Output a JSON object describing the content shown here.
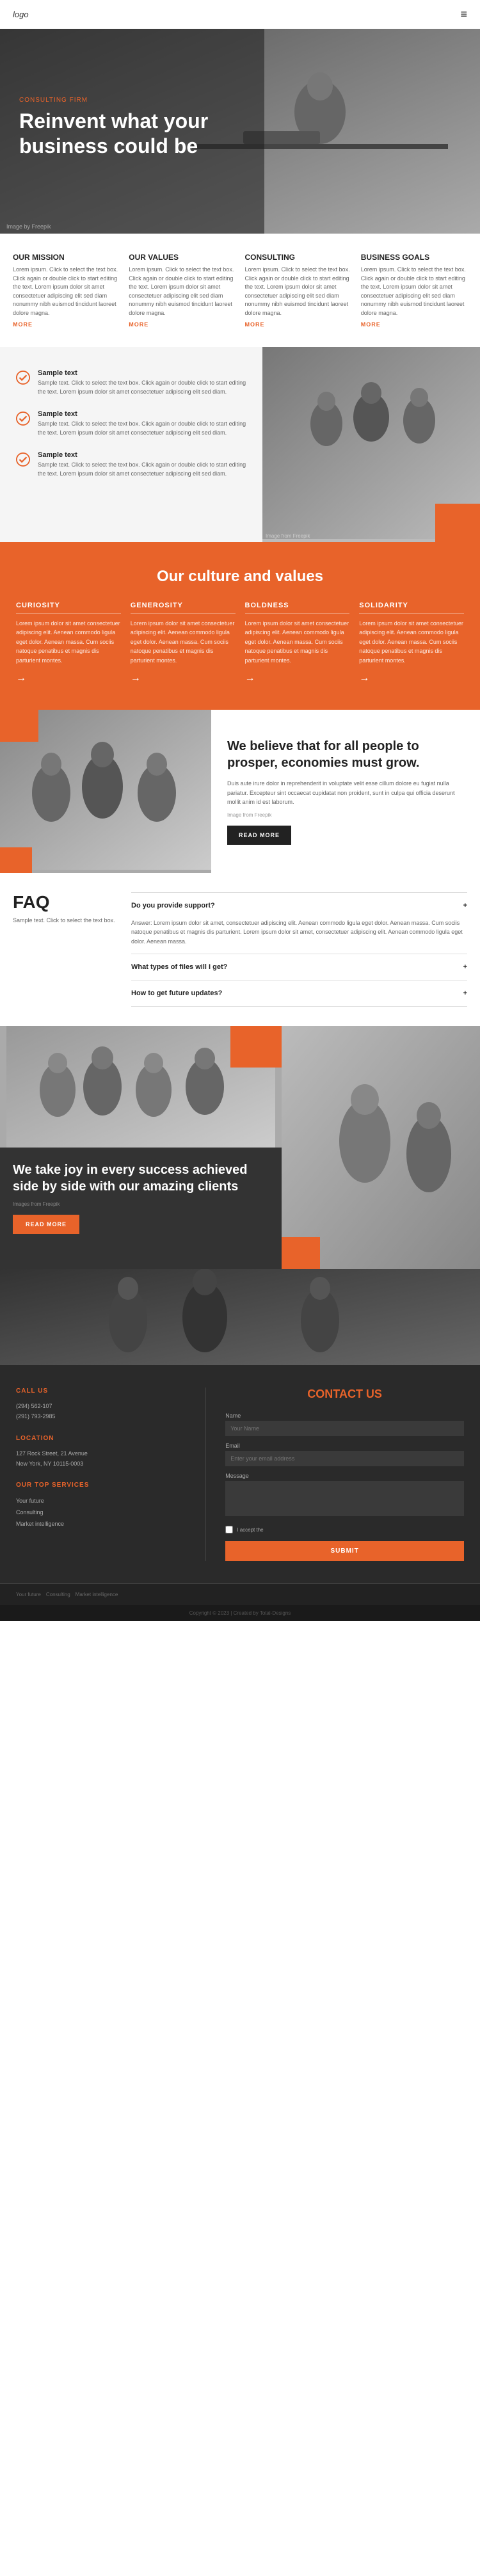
{
  "nav": {
    "logo": "logo",
    "menu_icon": "≡"
  },
  "hero": {
    "tag": "CONSULTING FIRM",
    "title": "Reinvent what your business could be",
    "img_credit": "Image by Freepik"
  },
  "four_cols": [
    {
      "heading": "Our Mission",
      "text": "Lorem ipsum. Click to select the text box. Click again or double click to start editing the text. Lorem ipsum dolor sit amet consectetuer adipiscing elit sed diam nonummy nibh euismod tincidunt laoreet dolore magna.",
      "more": "MORE"
    },
    {
      "heading": "Our Values",
      "text": "Lorem ipsum. Click to select the text box. Click again or double click to start editing the text. Lorem ipsum dolor sit amet consectetuer adipiscing elit sed diam nonummy nibh euismod tincidunt laoreet dolore magna.",
      "more": "MORE"
    },
    {
      "heading": "Consulting",
      "text": "Lorem ipsum. Click to select the text box. Click again or double click to start editing the text. Lorem ipsum dolor sit amet consectetuer adipiscing elit sed diam nonummy nibh euismod tincidunt laoreet dolore magna.",
      "more": "MORE"
    },
    {
      "heading": "Business Goals",
      "text": "Lorem ipsum. Click to select the text box. Click again or double click to start editing the text. Lorem ipsum dolor sit amet consectetuer adipiscing elit sed diam nonummy nibh euismod tincidunt laoreet dolore magna.",
      "more": "MORE"
    }
  ],
  "checklist": {
    "items": [
      {
        "title": "Sample text",
        "text": "Sample text. Click to select the text box. Click again or double click to start editing the text. Lorem ipsum dolor sit amet consectetuer adipiscing elit sed diam."
      },
      {
        "title": "Sample text",
        "text": "Sample text. Click to select the text box. Click again or double click to start editing the text. Lorem ipsum dolor sit amet consectetuer adipiscing elit sed diam."
      },
      {
        "title": "Sample text",
        "text": "Sample text. Click to select the text box. Click again or double click to start editing the text. Lorem ipsum dolor sit amet consectetuer adipiscing elit sed diam."
      }
    ],
    "img_credit": "Image from Freepik"
  },
  "culture": {
    "title": "Our culture and values",
    "cols": [
      {
        "heading": "CURIOSITY",
        "text": "Lorem ipsum dolor sit amet consectetuer adipiscing elit. Aenean commodo ligula eget dolor. Aenean massa. Cum sociis natoque penatibus et magnis dis parturient montes."
      },
      {
        "heading": "GENEROSITY",
        "text": "Lorem ipsum dolor sit amet consectetuer adipiscing elit. Aenean commodo ligula eget dolor. Aenean massa. Cum sociis natoque penatibus et magnis dis parturient montes."
      },
      {
        "heading": "BOLDNESS",
        "text": "Lorem ipsum dolor sit amet consectetuer adipiscing elit. Aenean commodo ligula eget dolor. Aenean massa. Cum sociis natoque penatibus et magnis dis parturient montes."
      },
      {
        "heading": "SOLIDARITY",
        "text": "Lorem ipsum dolor sit amet consectetuer adipiscing elit. Aenean commodo ligula eget dolor. Aenean massa. Cum sociis natoque penatibus et magnis dis parturient montes."
      }
    ]
  },
  "believe": {
    "title": "We believe that for all people to prosper, economies must grow.",
    "text1": "Duis aute irure dolor in reprehenderit in voluptate velit esse cillum dolore eu fugiat nulla pariatur. Excepteur sint occaecat cupidatat non proident, sunt in culpa qui officia deserunt mollit anim id est laborum.",
    "img_credit": "Image from Freepik",
    "read_more": "READ MORE"
  },
  "faq": {
    "title": "FAQ",
    "subtitle": "Sample text. Click to select the text box.",
    "items": [
      {
        "question": "Do you provide support?",
        "answer": "Answer: Lorem ipsum dolor sit amet, consectetuer adipiscing elit. Aenean commodo ligula eget dolor. Aenean massa. Cum sociis natoque penatibus et magnis dis parturient. Lorem ipsum dolor sit amet, consectetuer adipiscing elit. Aenean commodo ligula eget dolor. Aenean massa."
      },
      {
        "question": "What types of files will I get?",
        "answer": ""
      },
      {
        "question": "How to get future updates?",
        "answer": ""
      }
    ]
  },
  "success": {
    "title": "We take joy in every success achieved side by side with our amazing clients",
    "img_credit": "Images from Freepik",
    "read_more": "READ MORE"
  },
  "contact": {
    "section_title": "CONTACT US",
    "call_label": "CALL US",
    "phone1": "(294) 562-107",
    "phone2": "(291) 793-2985",
    "location_label": "LOCATION",
    "address1": "127 Rock Street, 21 Avenue",
    "address2": "New York, NY 10115-0003",
    "services_label": "OUR TOP SERVICES",
    "services": [
      "Your future",
      "Consulting",
      "Market intelligence"
    ],
    "form": {
      "title": "CONTACT US",
      "name_label": "Name",
      "name_placeholder": "Your Name",
      "email_label": "Email",
      "email_placeholder": "Enter your email address",
      "message_label": "Message",
      "message_placeholder": "",
      "checkbox_label": "I accept the",
      "submit": "SUBMIT"
    }
  },
  "footer": {
    "links": [
      "Your future",
      "Consulting",
      "Market intelligence"
    ],
    "copyright": "Copyright © 2023 | Created by Total-Designs"
  }
}
